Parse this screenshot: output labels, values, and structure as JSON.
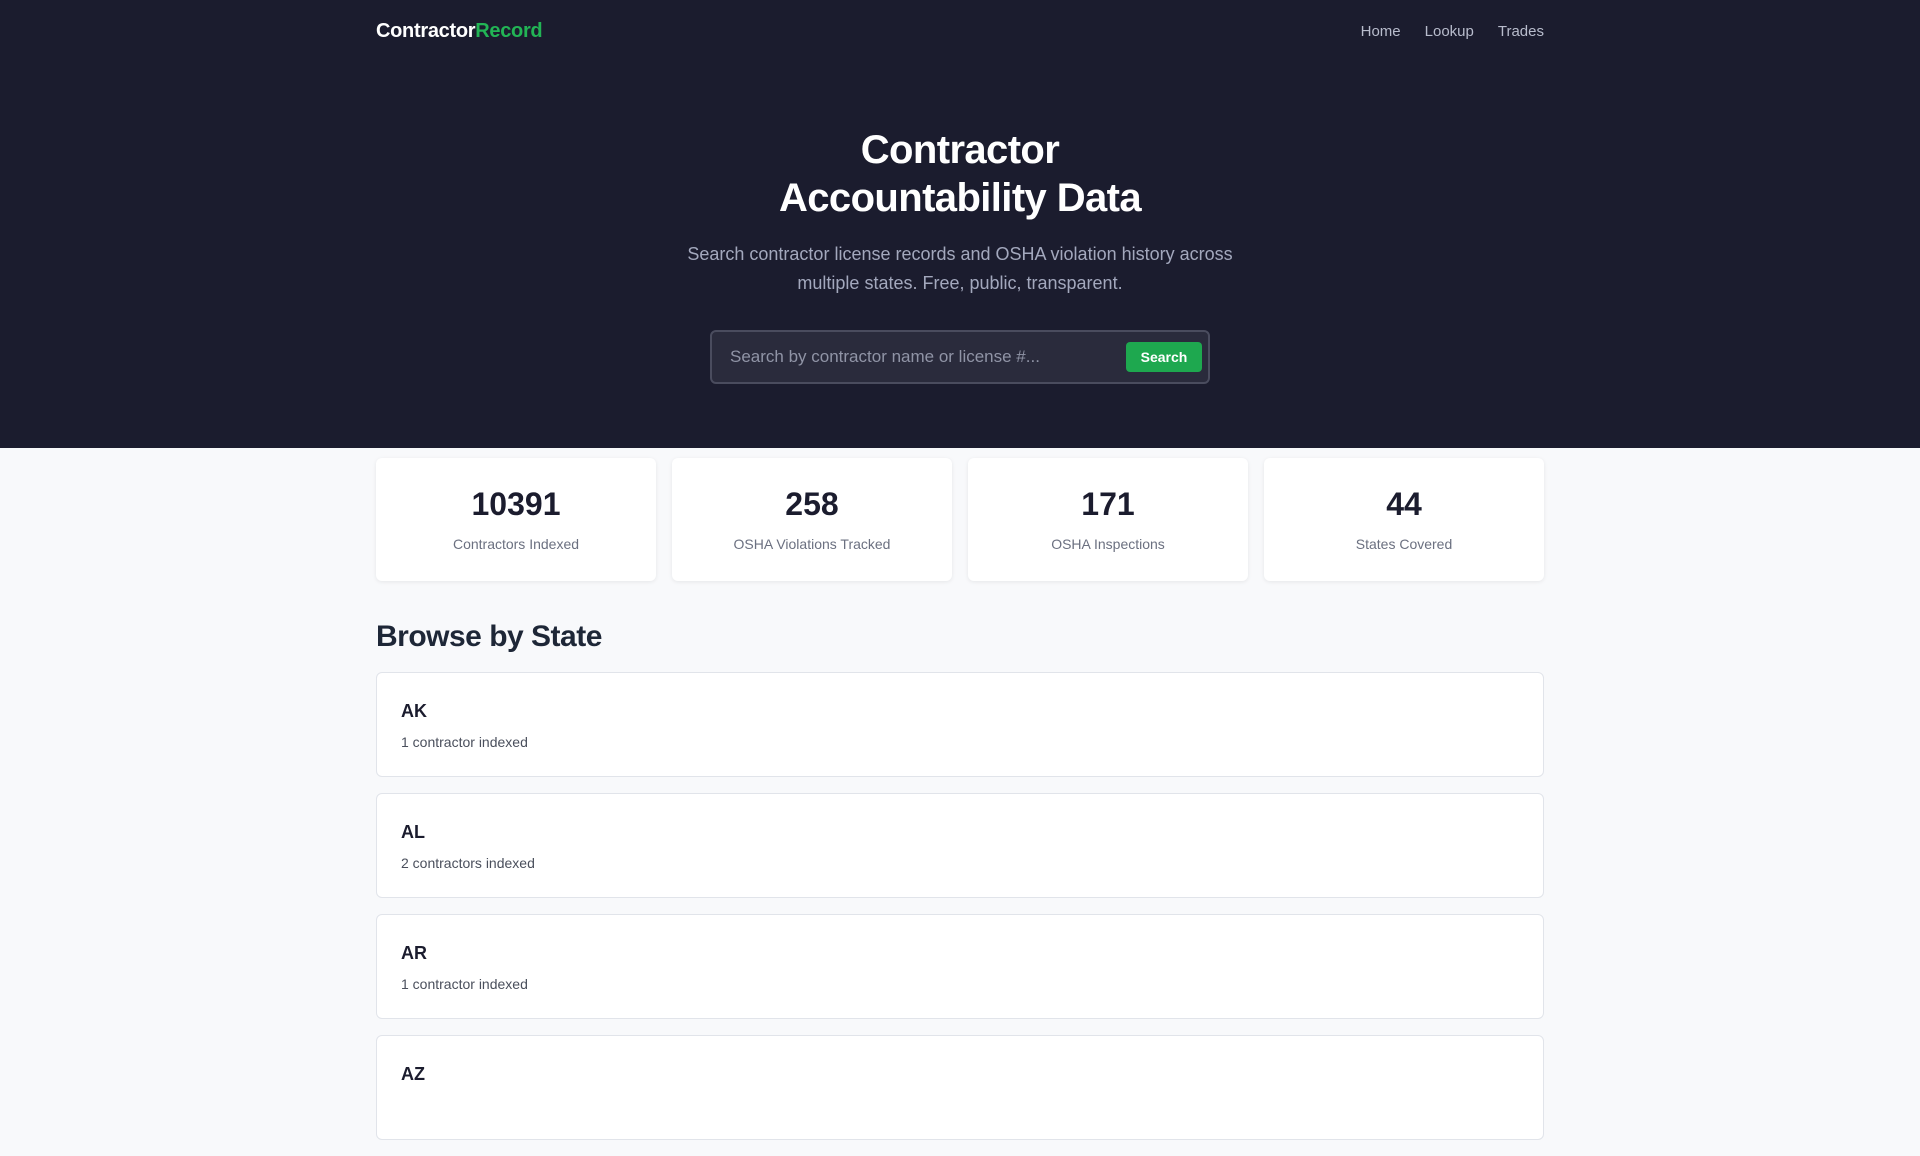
{
  "header": {
    "brand_main": "Contractor",
    "brand_accent": "Record",
    "nav": [
      {
        "label": "Home"
      },
      {
        "label": "Lookup"
      },
      {
        "label": "Trades"
      }
    ]
  },
  "hero": {
    "title_line1": "Contractor",
    "title_line2": "Accountability Data",
    "subtitle": "Search contractor license records and OSHA violation history across multiple states. Free, public, transparent.",
    "search_placeholder": "Search by contractor name or license #...",
    "search_value": "",
    "search_button": "Search"
  },
  "stats": [
    {
      "value": "10391",
      "label": "Contractors Indexed"
    },
    {
      "value": "258",
      "label": "OSHA Violations Tracked"
    },
    {
      "value": "171",
      "label": "OSHA Inspections"
    },
    {
      "value": "44",
      "label": "States Covered"
    }
  ],
  "browse": {
    "title": "Browse by State",
    "states": [
      {
        "code": "AK",
        "count": "1 contractor indexed"
      },
      {
        "code": "AL",
        "count": "2 contractors indexed"
      },
      {
        "code": "AR",
        "count": "1 contractor indexed"
      },
      {
        "code": "AZ",
        "count": ""
      }
    ]
  },
  "colors": {
    "header_bg": "#1b1c2e",
    "accent_green": "#22b455",
    "button_green": "#1ea84f",
    "page_bg": "#f8f9fb"
  }
}
